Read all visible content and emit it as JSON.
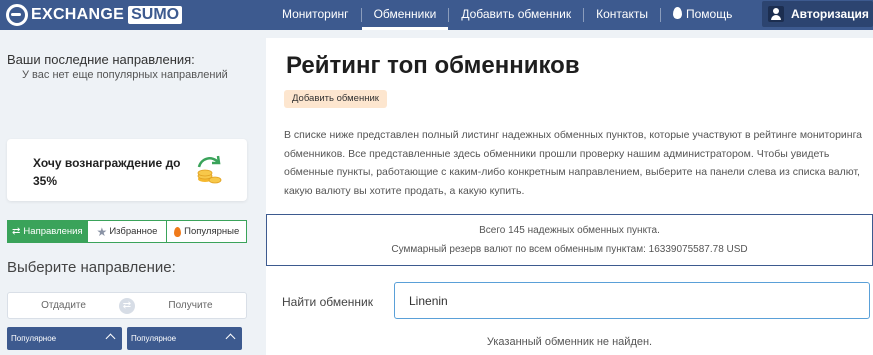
{
  "header": {
    "logo_left": "EXCHANGE",
    "logo_right": "SUMO",
    "nav": [
      {
        "label": "Мониторинг"
      },
      {
        "label": "Обменники"
      },
      {
        "label": "Добавить обменник"
      },
      {
        "label": "Контакты"
      },
      {
        "label": "Помощь"
      }
    ],
    "auth_label": "Авторизация"
  },
  "sidebar": {
    "recent_title": "Ваши последние направления:",
    "recent_empty": "У вас нет еще популярных направлений",
    "reward_text": "Хочу вознаграждение до 35%",
    "tabs": [
      {
        "label": "Направления"
      },
      {
        "label": "Избранное"
      },
      {
        "label": "Популярные"
      }
    ],
    "choose_title": "Выберите направление:",
    "give_label": "Отдадите",
    "get_label": "Получите",
    "popular_left": "Популярное",
    "popular_right": "Популярное"
  },
  "main": {
    "title": "Рейтинг топ обменников",
    "add_badge": "Добавить обменник",
    "description": "В списке ниже представлен полный листинг надежных обменных пунктов, которые участвуют в рейтинге мониторинга обменников. Все представленные здесь обменники прошли проверку нашим администратором. Чтобы увидеть обменные пункты, работающие с каким-либо конкретным направлением, выберите на панели слева из списка валют, какую валюту вы хотите продать, а какую купить.",
    "stats_total": "Всего 145 надежных обменных пункта.",
    "stats_reserve": "Суммарный резерв валют по всем обменным пунктам: 16339075587.78 USD",
    "search_label": "Найти обменник",
    "search_value": "Linenin",
    "not_found": "Указанный обменник не найден."
  },
  "colors": {
    "header_bg": "#3d5a8f",
    "accent_green": "#3aa35a",
    "badge_bg": "#fde6cf",
    "input_border": "#5aa0d8"
  }
}
